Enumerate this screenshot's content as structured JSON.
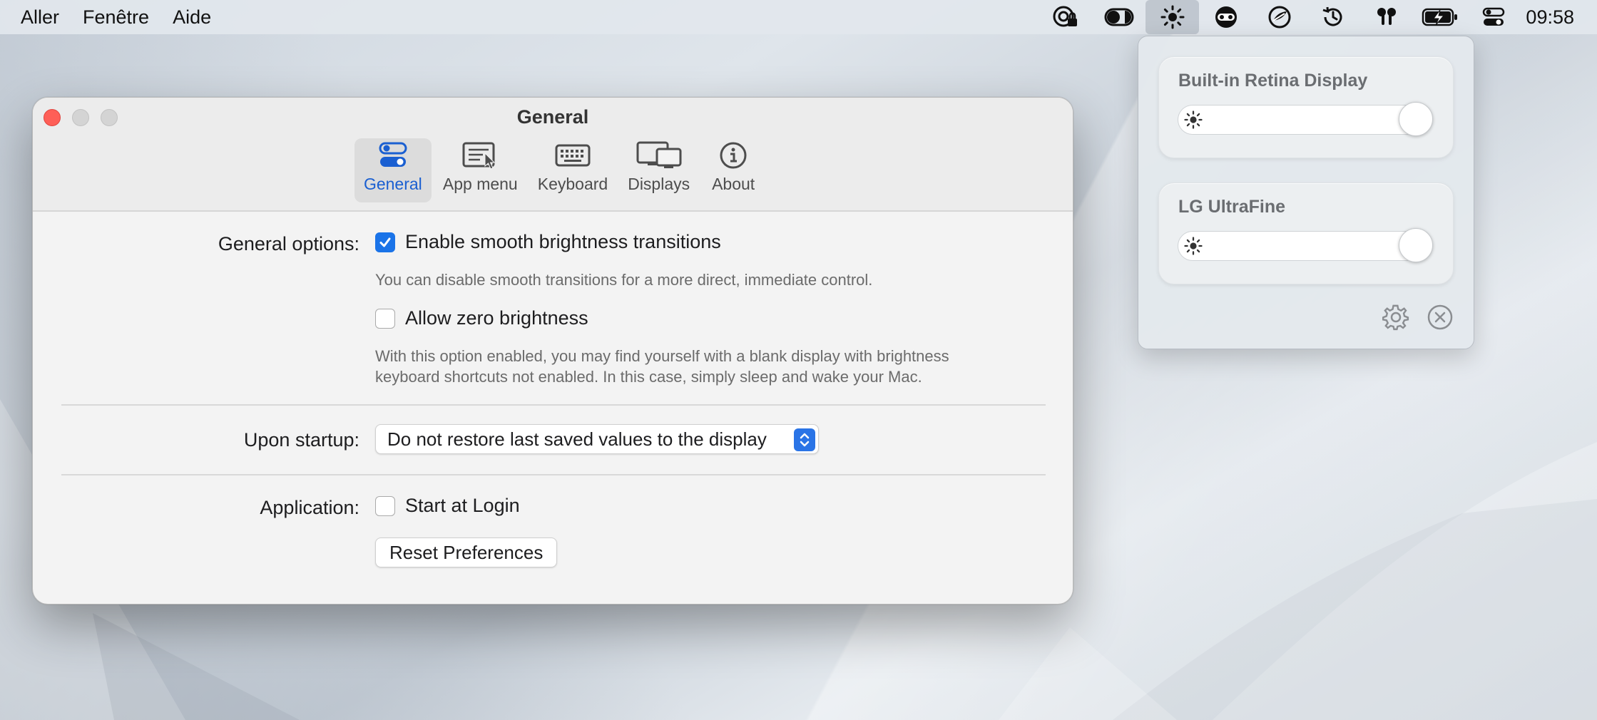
{
  "menubar": {
    "items": [
      "Aller",
      "Fenêtre",
      "Aide"
    ],
    "status_icons": [
      "vpn-lock-icon",
      "toggle-dark-mode-icon",
      "brightness-sun-icon",
      "screen-mask-icon",
      "compass-icon",
      "time-machine-icon",
      "airpods-icon",
      "battery-charging-icon",
      "control-center-icon"
    ],
    "clock": "09:58"
  },
  "window": {
    "title": "General",
    "tabs": [
      {
        "label": "General",
        "icon": "toggles-icon",
        "selected": true
      },
      {
        "label": "App menu",
        "icon": "app-menu-icon",
        "selected": false
      },
      {
        "label": "Keyboard",
        "icon": "keyboard-icon",
        "selected": false
      },
      {
        "label": "Displays",
        "icon": "displays-icon",
        "selected": false
      },
      {
        "label": "About",
        "icon": "info-icon",
        "selected": false
      }
    ],
    "general_options": {
      "label": "General options:",
      "smooth": {
        "label": "Enable smooth brightness transitions",
        "checked": true,
        "hint": "You can disable smooth transitions for a more direct, immediate control."
      },
      "zero": {
        "label": "Allow zero brightness",
        "checked": false,
        "hint_line1": "With this option enabled, you may find yourself with a blank display with brightness",
        "hint_line2": "keyboard shortcuts not enabled. In this case, simply sleep and wake your Mac."
      }
    },
    "startup": {
      "label": "Upon startup:",
      "selected": "Do not restore last saved values to the display"
    },
    "application": {
      "label": "Application:",
      "start_login": {
        "label": "Start at Login",
        "checked": false
      },
      "reset_button": "Reset Preferences"
    }
  },
  "popover": {
    "displays": [
      {
        "name": "Built-in Retina Display",
        "brightness": 1.0
      },
      {
        "name": "LG UltraFine",
        "brightness": 1.0
      }
    ],
    "footer_icons": [
      "settings-gear-icon",
      "quit-circle-x-icon"
    ]
  },
  "colors": {
    "accent": "#1a73e8",
    "close": "#fe5f57"
  }
}
